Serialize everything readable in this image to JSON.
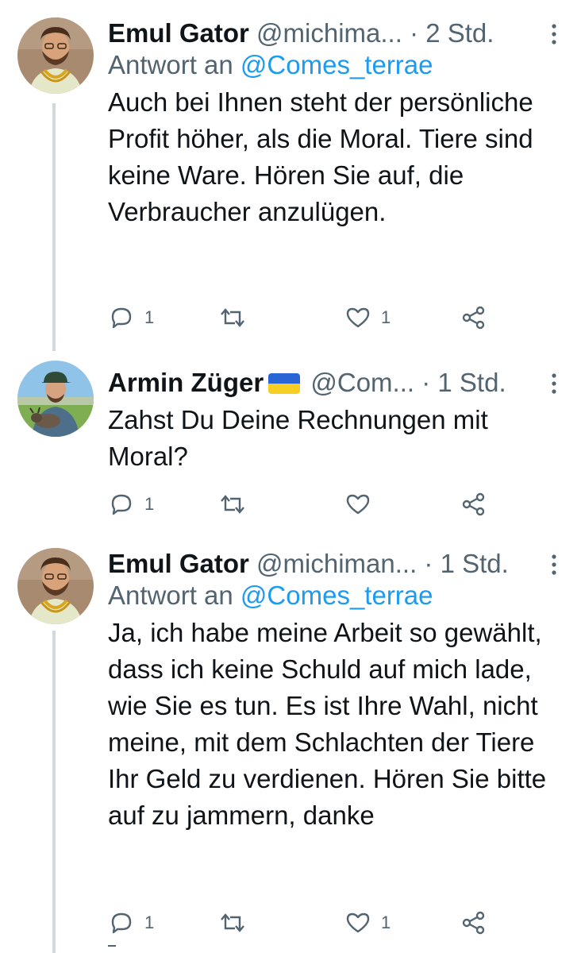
{
  "tweets": [
    {
      "name": "Emul Gator",
      "handle": "@michima...",
      "separator": "·",
      "time": "2 Std.",
      "reply_label": "Antwort an",
      "reply_mention": "@Comes_terrae",
      "text": "Auch bei Ihnen steht der persönliche Profit höher, als die Moral. Tiere sind keine Ware. Hören Sie auf, die Verbraucher anzulügen.",
      "reply_count": "1",
      "retweet_count": "",
      "like_count": "1",
      "avatar_icon": "bearded-man-gold-chain-avatar"
    },
    {
      "name": "Armin Züger",
      "flag": "ukraine-flag-emoji",
      "handle": "@Com...",
      "separator": "·",
      "time": "1 Std.",
      "text": "Zahst Du Deine Rechnungen mit Moral?",
      "reply_count": "1",
      "retweet_count": "",
      "like_count": "",
      "avatar_icon": "man-holding-goat-avatar"
    },
    {
      "name": "Emul Gator",
      "handle": "@michiman...",
      "separator": "·",
      "time": "1 Std.",
      "reply_label": "Antwort an",
      "reply_mention": "@Comes_terrae",
      "text": "Ja, ich habe meine Arbeit so gewählt, dass ich keine Schuld auf mich lade, wie Sie es tun. Es ist Ihre Wahl, nicht meine, mit dem Schlachten der Tiere Ihr Geld zu verdienen. Hören Sie bitte auf zu jammern, danke",
      "reply_count": "1",
      "retweet_count": "",
      "like_count": "1",
      "avatar_icon": "bearded-man-gold-chain-avatar"
    }
  ],
  "colors": {
    "primary_text": "#0f1419",
    "secondary_text": "#536471",
    "link": "#1d9bf0",
    "thread_line": "#cfd9de"
  }
}
